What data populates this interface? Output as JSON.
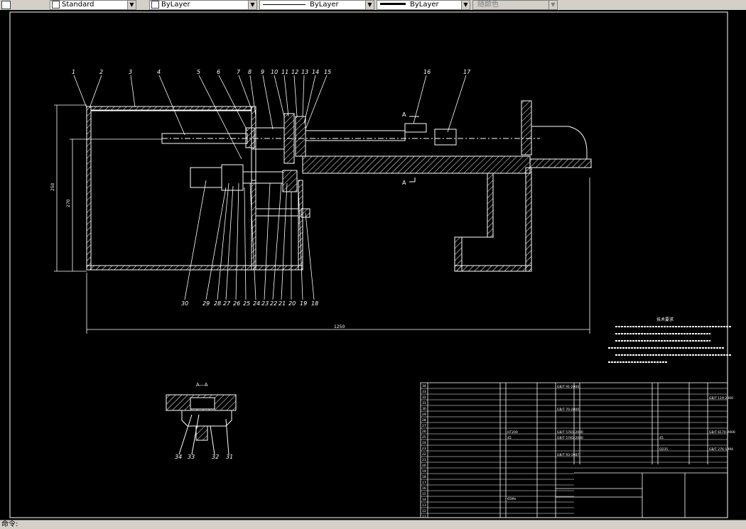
{
  "toolbar": {
    "textstyle": "Standard",
    "layer": "ByLayer",
    "linetype": "ByLayer",
    "lineweight": "ByLayer",
    "plotstyle": "随颜色"
  },
  "drawing": {
    "part_numbers_top": [
      "1",
      "2",
      "3",
      "4",
      "5",
      "6",
      "7",
      "8",
      "9",
      "10",
      "11",
      "12",
      "13",
      "14",
      "15",
      "16",
      "17"
    ],
    "part_numbers_bottom": [
      "30",
      "29",
      "28",
      "27",
      "26",
      "25",
      "24",
      "23",
      "22",
      "21",
      "20",
      "19",
      "18"
    ],
    "section_labels": [
      "A",
      "A"
    ],
    "section_title": "A—A",
    "section_part_numbers": [
      "34",
      "33",
      "32",
      "31"
    ],
    "dim_overall": "1250",
    "dim_height_left": "250",
    "dim_height_inner": "270",
    "tech_req_title": "技术要求",
    "bom_codes_left": [
      "GB/T 91-2000",
      "GB/T 70-2000",
      "GB/T 5781-2000",
      "GB/T 5781-2000",
      "GB/T 93-1987"
    ],
    "bom_codes_right": [
      "GB/T 119-2000",
      "GB/T 6170-2000",
      "GB/T 276-1994"
    ],
    "materials": [
      "HT200",
      "45",
      "Q235",
      "45",
      "65Mn"
    ],
    "row_numbers": [
      "34",
      "33",
      "32",
      "31",
      "30",
      "29",
      "28",
      "27",
      "26",
      "25",
      "24",
      "23",
      "22",
      "21",
      "20",
      "19",
      "18",
      "17",
      "16",
      "15",
      "14",
      "13",
      "12",
      "11"
    ],
    "status_prefix": "命令:"
  }
}
